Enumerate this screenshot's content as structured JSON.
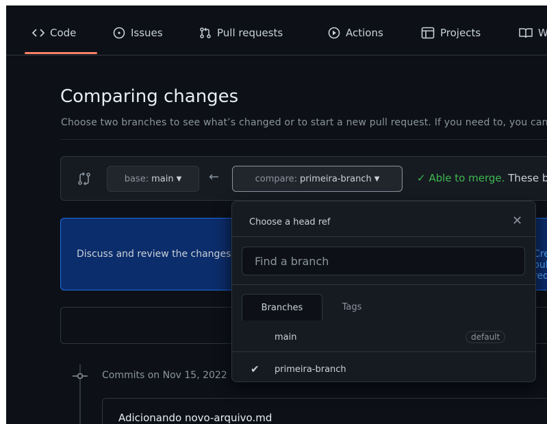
{
  "nav": {
    "tabs": [
      {
        "label": "Code",
        "icon": "code-icon"
      },
      {
        "label": "Issues",
        "icon": "issue-opened-icon"
      },
      {
        "label": "Pull requests",
        "icon": "git-pull-request-icon"
      },
      {
        "label": "Actions",
        "icon": "play-icon"
      },
      {
        "label": "Projects",
        "icon": "table-icon"
      },
      {
        "label": "Wiki",
        "icon": "book-icon"
      }
    ],
    "active": "Code"
  },
  "page": {
    "title": "Comparing changes",
    "subtitle": "Choose two branches to see what’s changed or to start a new pull request. If you need to, you can also compare across forks."
  },
  "range": {
    "base_prefix": "base:",
    "base_value": "main",
    "compare_prefix": "compare:",
    "compare_value": "primeira-branch",
    "merge_status": "✓ Able to merge.",
    "merge_status_rest": " These branches can be automatically merged."
  },
  "discuss": {
    "text": "Discuss and review the changes in this comparison with others.",
    "link": "Create pull request"
  },
  "commits": {
    "group_label": "Commits on Nov 15, 2022",
    "first_commit": "Adicionando novo-arquivo.md"
  },
  "dropdown": {
    "title": "Choose a head ref",
    "search_placeholder": "Find a branch",
    "tabs": [
      "Branches",
      "Tags"
    ],
    "branches": [
      {
        "name": "main",
        "badge": "default",
        "selected": false
      },
      {
        "name": "primeira-branch",
        "badge": "",
        "selected": true
      }
    ]
  },
  "colors": {
    "background": "#0d1117",
    "accent_underline": "#f78166",
    "success": "#3fb950",
    "link": "#58a6ff",
    "flash_bg": "#0c2d6b"
  }
}
